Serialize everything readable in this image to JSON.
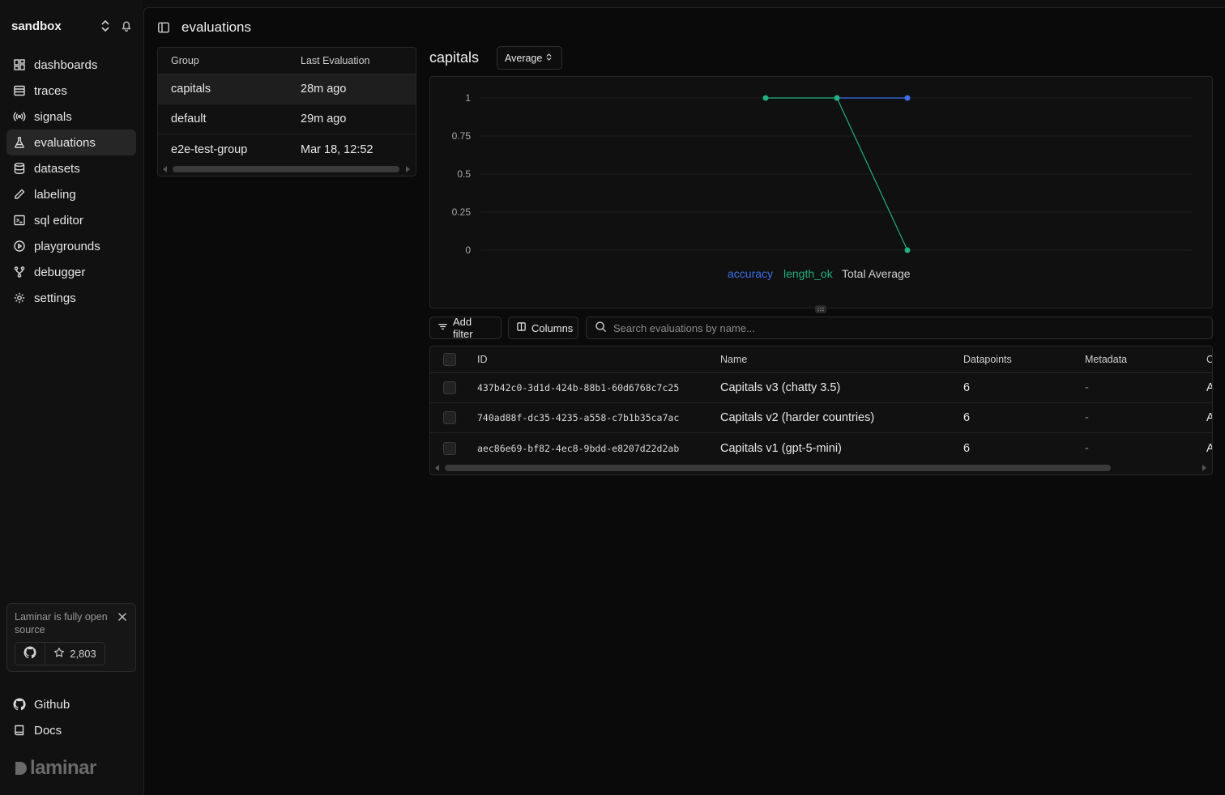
{
  "workspace": {
    "name": "sandbox"
  },
  "nav": {
    "items": [
      {
        "label": "dashboards",
        "icon": "dashboard-icon"
      },
      {
        "label": "traces",
        "icon": "traces-icon"
      },
      {
        "label": "signals",
        "icon": "signals-icon"
      },
      {
        "label": "evaluations",
        "icon": "flask-icon",
        "active": true
      },
      {
        "label": "datasets",
        "icon": "database-icon"
      },
      {
        "label": "labeling",
        "icon": "pen-icon"
      },
      {
        "label": "sql editor",
        "icon": "terminal-icon"
      },
      {
        "label": "playgrounds",
        "icon": "play-circle-icon"
      },
      {
        "label": "debugger",
        "icon": "git-branch-icon"
      },
      {
        "label": "settings",
        "icon": "gear-icon"
      }
    ]
  },
  "promo": {
    "text": "Laminar is fully open source",
    "stars": "2,803"
  },
  "bottom_links": [
    {
      "label": "Github",
      "icon": "github-icon"
    },
    {
      "label": "Docs",
      "icon": "book-icon"
    }
  ],
  "brand": {
    "name": "laminar"
  },
  "page": {
    "title": "evaluations"
  },
  "groups_table": {
    "columns": [
      "Group",
      "Last Evaluation"
    ],
    "rows": [
      {
        "group": "capitals",
        "last": "28m ago",
        "selected": true
      },
      {
        "group": "default",
        "last": "29m ago"
      },
      {
        "group": "e2e-test-group",
        "last": "Mar 18, 12:52"
      }
    ]
  },
  "chart_panel": {
    "title": "capitals",
    "aggregation": "Average"
  },
  "chart_data": {
    "type": "line",
    "title": "capitals",
    "ylim": [
      0,
      1
    ],
    "yticks": [
      "1",
      "0.75",
      "0.5",
      "0.25",
      "0"
    ],
    "legend": "bottom",
    "grid": true,
    "x": [
      1,
      2,
      3
    ],
    "series": [
      {
        "name": "accuracy",
        "color": "#3b6ee8",
        "values": [
          null,
          1,
          1
        ]
      },
      {
        "name": "length_ok",
        "color": "#22b07d",
        "values": [
          1,
          1,
          0
        ]
      },
      {
        "name": "Total Average",
        "color": "#cfcfcf",
        "values": [
          null,
          null,
          null
        ]
      }
    ]
  },
  "toolbar": {
    "add_filter": "Add filter",
    "columns": "Columns",
    "search_placeholder": "Search evaluations by name..."
  },
  "evals_table": {
    "columns": [
      "ID",
      "Name",
      "Datapoints",
      "Metadata",
      "C"
    ],
    "rows": [
      {
        "id": "437b42c0-3d1d-424b-88b1-60d6768c7c25",
        "name": "Capitals v3 (chatty 3.5)",
        "datapoints": "6",
        "metadata": "-",
        "extra": "A"
      },
      {
        "id": "740ad88f-dc35-4235-a558-c7b1b35ca7ac",
        "name": "Capitals v2 (harder countries)",
        "datapoints": "6",
        "metadata": "-",
        "extra": "A"
      },
      {
        "id": "aec86e69-bf82-4ec8-9bdd-e8207d22d2ab",
        "name": "Capitals v1 (gpt-5-mini)",
        "datapoints": "6",
        "metadata": "-",
        "extra": "A"
      }
    ]
  }
}
